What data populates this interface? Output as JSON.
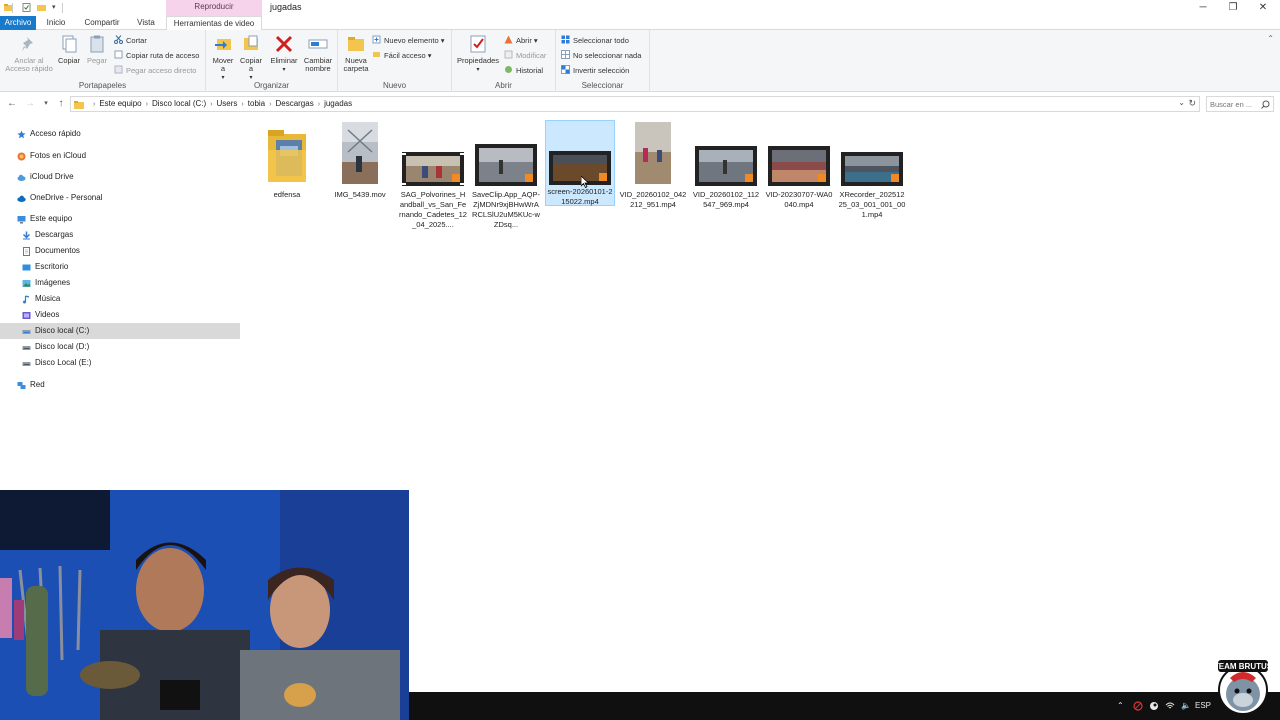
{
  "window": {
    "title": "jugadas",
    "context_tab": "Reproducir",
    "controls": [
      "minimize-icon",
      "restore-icon",
      "close-icon"
    ]
  },
  "tabs": {
    "file": "Archivo",
    "home": "Inicio",
    "share": "Compartir",
    "view": "Vista",
    "video_tools": "Herramientas de video"
  },
  "ribbon": {
    "clipboard": {
      "label": "Portapapeles",
      "pin": "Anclar al Acceso rápido",
      "copy": "Copiar",
      "paste": "Pegar",
      "cut": "Cortar",
      "copy_path": "Copiar ruta de acceso",
      "paste_shortcut": "Pegar acceso directo"
    },
    "organize": {
      "label": "Organizar",
      "move": "Mover a",
      "copy_to": "Copiar a",
      "delete": "Eliminar",
      "rename": "Cambiar nombre"
    },
    "new": {
      "label": "Nuevo",
      "new_folder": "Nueva carpeta",
      "new_item": "Nuevo elemento",
      "easy_access": "Fácil acceso"
    },
    "open": {
      "label": "Abrir",
      "properties": "Propiedades",
      "open": "Abrir",
      "edit": "Modificar",
      "history": "Historial"
    },
    "select": {
      "label": "Seleccionar",
      "select_all": "Seleccionar todo",
      "select_none": "No seleccionar nada",
      "invert": "Invertir selección"
    }
  },
  "address": {
    "crumbs": [
      "Este equipo",
      "Disco local (C:)",
      "Users",
      "tobia",
      "Descargas",
      "jugadas"
    ],
    "search_placeholder": "Buscar en ..."
  },
  "nav": {
    "quick_access": "Acceso rápido",
    "icloud_photos": "Fotos en iCloud",
    "icloud_drive": "iCloud Drive",
    "onedrive": "OneDrive - Personal",
    "this_pc": "Este equipo",
    "downloads": "Descargas",
    "documents": "Documentos",
    "desktop": "Escritorio",
    "pictures": "Imágenes",
    "music": "Música",
    "videos": "Videos",
    "disk_c": "Disco local (C:)",
    "disk_d": "Disco local (D:)",
    "disk_e": "Disco Local (E:)",
    "network": "Red"
  },
  "files": [
    {
      "name": "edfensa",
      "kind": "folder"
    },
    {
      "name": "IMG_5439.mov",
      "kind": "photo"
    },
    {
      "name": "SAG_Polvorines_Handball_vs_San_Fernando_Cadetes_12_04_2025....",
      "kind": "video"
    },
    {
      "name": "SaveClip.App_AQP-ZjMDNr9xjBHwWrARCLSlU2uM5KUc-wZDsq...",
      "kind": "video"
    },
    {
      "name": "screen-20260101-215022.mp4",
      "kind": "video",
      "selected": true
    },
    {
      "name": "VID_20260102_042212_951.mp4",
      "kind": "photo"
    },
    {
      "name": "VID_20260102_112547_969.mp4",
      "kind": "video"
    },
    {
      "name": "VID-20230707-WA0040.mp4",
      "kind": "video"
    },
    {
      "name": "XRecorder_20251225_03_001_001_001.mp4",
      "kind": "video"
    }
  ],
  "taskbar": {
    "language": "ESP"
  },
  "overlay": {
    "logo_text": "TEAM BRUTUS"
  }
}
